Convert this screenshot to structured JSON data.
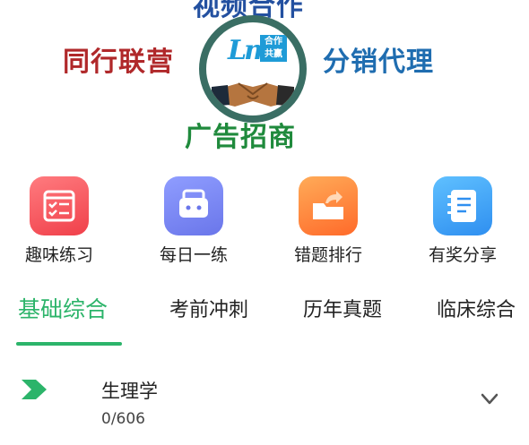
{
  "banner": {
    "top_text": "视频合作",
    "left_text": "同行联营",
    "right_text": "分销代理",
    "bottom_text": "广告招商",
    "logo_text": "Lm",
    "logo_badge_line1": "合作",
    "logo_badge_line2": "共赢"
  },
  "quick_actions": [
    {
      "label": "趣味练习",
      "icon": "quiz-list-icon",
      "color": "#f0404a"
    },
    {
      "label": "每日一练",
      "icon": "daily-box-icon",
      "color": "#6a76ea"
    },
    {
      "label": "错题排行",
      "icon": "folder-share-icon",
      "color": "#ff6a2a"
    },
    {
      "label": "有奖分享",
      "icon": "notebook-icon",
      "color": "#2f8ff0"
    }
  ],
  "tabs": [
    {
      "label": "基础综合",
      "active": true
    },
    {
      "label": "考前冲刺",
      "active": false
    },
    {
      "label": "历年真题",
      "active": false
    },
    {
      "label": "临床综合",
      "active": false
    }
  ],
  "list": [
    {
      "title": "生理学",
      "progress": "0/606"
    }
  ],
  "colors": {
    "accent": "#2cb46a"
  }
}
